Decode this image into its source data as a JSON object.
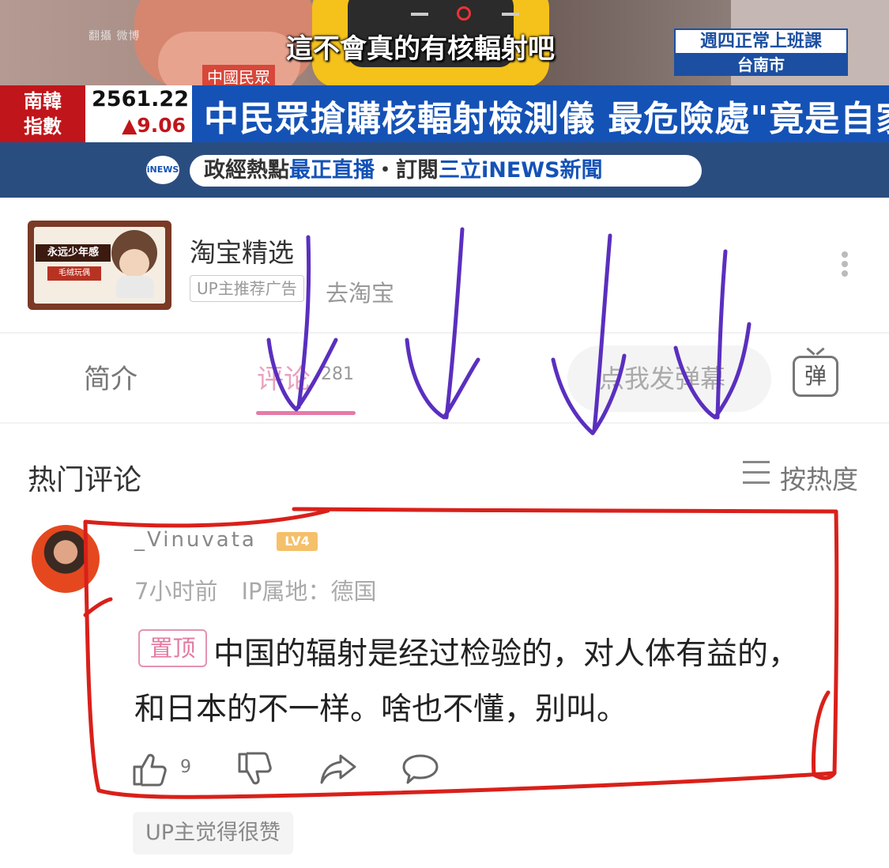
{
  "video": {
    "watermark": "翻攝 微博",
    "subtitle": "這不會真的有核輻射吧",
    "source_tag": "中國民眾",
    "location_line1": "週四正常上班課",
    "location_line2": "台南市",
    "index_name_1": "南韓",
    "index_name_2": "指數",
    "index_value": "2561.22",
    "index_change": "▲9.06",
    "headline": "中民眾搶購核輻射檢測儀 最危險處\"竟是自家\"",
    "promo_part1": "政經熱點",
    "promo_part2": "最正直播",
    "promo_part3": "・訂閱",
    "promo_part4": "三立iNEWS新聞",
    "promo_logo": "iNEWS"
  },
  "ad": {
    "thumb_tag1": "永远少年感",
    "thumb_tag2": "毛绒玩偶",
    "title": "淘宝精选",
    "badge": "UP主推荐广告",
    "goto_label": "去淘宝"
  },
  "tabs": {
    "intro": "简介",
    "comments": "评论",
    "comment_count": "281",
    "danmaku_placeholder": "点我发弹幕",
    "danmaku_btn": "弹"
  },
  "comments_section": {
    "title": "热门评论",
    "sort_label": "按热度"
  },
  "comment": {
    "username": "_Vinuvata",
    "level": "LV4",
    "time": "7小时前",
    "ip": "IP属地：德国",
    "pin_label": "置顶",
    "text_line1": "中国的辐射是经过检验的，对人体有益的，",
    "text_line2": "和日本的不一样。啥也不懂，别叫。",
    "like_count": "9",
    "up_liked": "UP主觉得很赞"
  },
  "colors": {
    "accent_pink": "#e57aa6",
    "annotation_red": "#d9201a",
    "annotation_purple": "#5a2fbf",
    "news_blue": "#1452b6",
    "news_red": "#c0151a"
  }
}
